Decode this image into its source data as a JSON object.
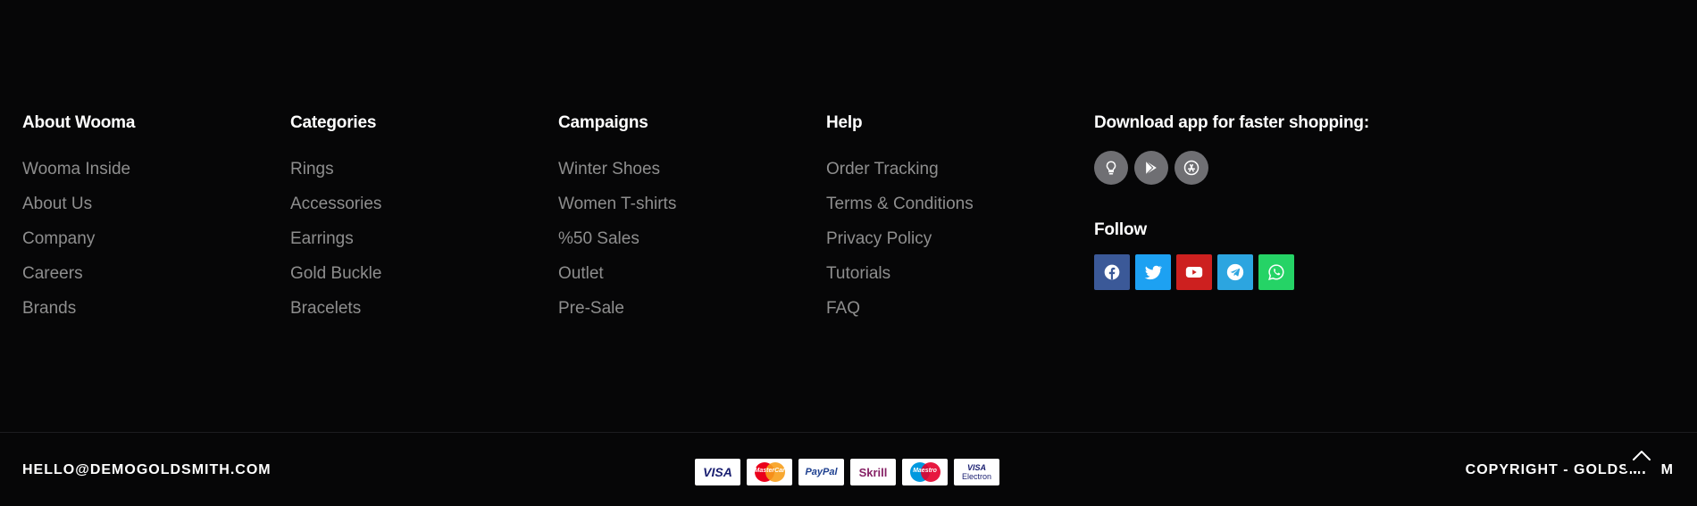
{
  "columns": [
    {
      "title": "About Wooma",
      "items": [
        "Wooma Inside",
        "About Us",
        "Company",
        "Careers",
        "Brands"
      ]
    },
    {
      "title": "Categories",
      "items": [
        "Rings",
        "Accessories",
        "Earrings",
        "Gold Buckle",
        "Bracelets"
      ]
    },
    {
      "title": "Campaigns",
      "items": [
        "Winter Shoes",
        "Women T-shirts",
        "%50 Sales",
        "Outlet",
        "Pre-Sale"
      ]
    },
    {
      "title": "Help",
      "items": [
        "Order Tracking",
        "Terms & Conditions",
        "Privacy Policy",
        "Tutorials",
        "FAQ"
      ]
    }
  ],
  "download": {
    "title": "Download app for faster shopping:",
    "apps": [
      "lightbulb-icon",
      "google-play-icon",
      "app-store-icon"
    ]
  },
  "follow": {
    "title": "Follow",
    "networks": [
      {
        "icon": "facebook-icon",
        "color": "#3b5998"
      },
      {
        "icon": "twitter-icon",
        "color": "#1da1f2"
      },
      {
        "icon": "youtube-icon",
        "color": "#cd201f"
      },
      {
        "icon": "telegram-icon",
        "color": "#2ca5e0"
      },
      {
        "icon": "whatsapp-icon",
        "color": "#25d366"
      }
    ]
  },
  "bottom": {
    "email": "HELLO@DEMOGOLDSMITH.COM",
    "copyright_start": "COPYRIGHT - GOLDSMI",
    "copyright_end": "M",
    "payments": {
      "visa": "VISA",
      "mastercard": "MasterCard",
      "paypal": "PayPal",
      "skrill": "Skrill",
      "maestro": "Maestro",
      "visa_electron_1": "VISA",
      "visa_electron_2": "Electron"
    }
  },
  "colors": {
    "background": "#060607",
    "heading": "#ffffff",
    "link": "#8e8e8e",
    "app_button": "#6f6f73"
  }
}
